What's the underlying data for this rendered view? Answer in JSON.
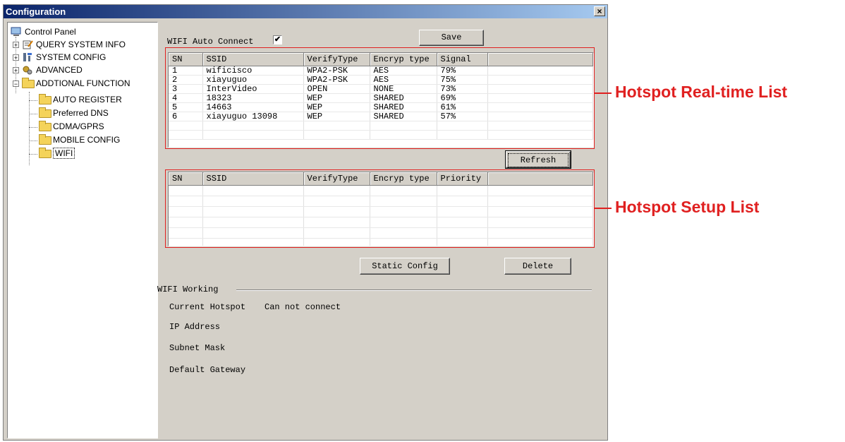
{
  "window": {
    "title": "Configuration",
    "close_glyph": "×"
  },
  "tree": {
    "root": "Control Panel",
    "items": [
      {
        "label": "QUERY SYSTEM INFO",
        "icon": "notepad-icon"
      },
      {
        "label": "SYSTEM CONFIG",
        "icon": "system-config-icon"
      },
      {
        "label": "ADVANCED",
        "icon": "gears-icon"
      },
      {
        "label": "ADDTIONAL FUNCTION",
        "icon": "folder-open-icon"
      },
      {
        "label": "AUTO REGISTER",
        "icon": "folder-icon"
      },
      {
        "label": "Preferred DNS",
        "icon": "folder-icon"
      },
      {
        "label": "CDMA/GPRS",
        "icon": "folder-icon"
      },
      {
        "label": "MOBILE CONFIG",
        "icon": "folder-icon"
      },
      {
        "label": "WIFI",
        "icon": "folder-open-icon"
      }
    ]
  },
  "wifi": {
    "auto_connect_label": "WIFI Auto Connect",
    "auto_connect_checked": "✔",
    "save": "Save",
    "refresh": "Refresh",
    "static_config": "Static Config",
    "delete": "Delete"
  },
  "realtime_list": {
    "columns": [
      "SN",
      "SSID",
      "VerifyType",
      "Encryp type",
      "Signal",
      ""
    ],
    "rows": [
      [
        "1",
        "wificisco",
        "WPA2-PSK",
        "AES",
        "79%"
      ],
      [
        "2",
        "xiayuguo",
        "WPA2-PSK",
        "AES",
        "75%"
      ],
      [
        "3",
        "InterVideo",
        "OPEN",
        "NONE",
        "73%"
      ],
      [
        "4",
        "18323",
        "WEP",
        "SHARED",
        "69%"
      ],
      [
        "5",
        "14663",
        "WEP",
        "SHARED",
        "61%"
      ],
      [
        "6",
        "xiayuguo 13098",
        "WEP",
        "SHARED",
        "57%"
      ]
    ]
  },
  "setup_list": {
    "columns": [
      "SN",
      "SSID",
      "VerifyType",
      "Encryp type",
      "Priority",
      ""
    ]
  },
  "working": {
    "group_label": "WIFI Working",
    "current_hotspot_label": "Current Hotspot",
    "current_hotspot_value": "Can not connect",
    "ip_label": "IP Address",
    "subnet_label": "Subnet Mask",
    "gateway_label": "Default Gateway"
  },
  "annotations": {
    "realtime": "Hotspot Real-time List",
    "setup": "Hotspot Setup List"
  }
}
